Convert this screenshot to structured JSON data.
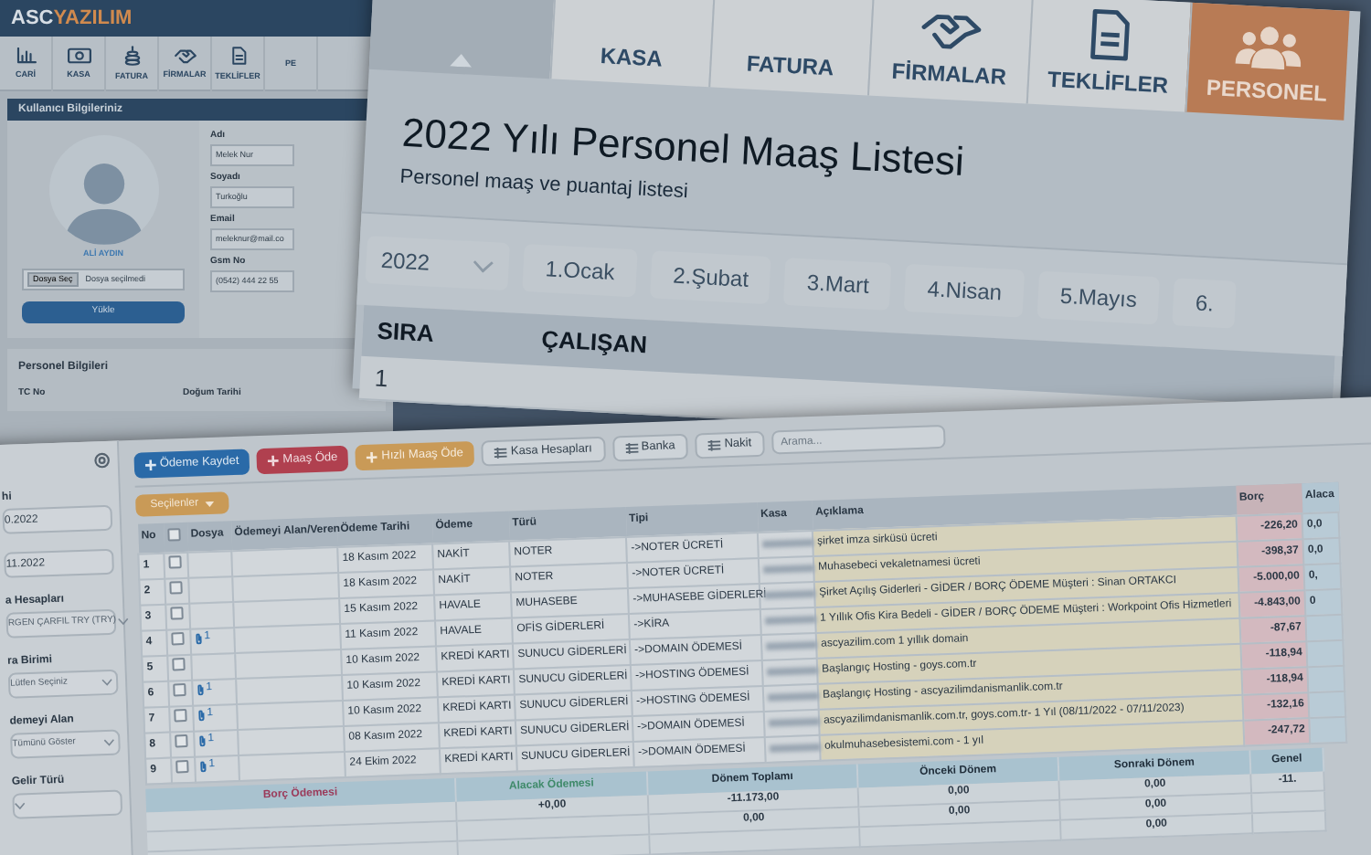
{
  "profile_window": {
    "logo_prefix": "ASC",
    "logo_suffix": "YAZILIM",
    "toolbar": [
      "CARİ",
      "KASA",
      "FATURA",
      "FİRMALAR",
      "TEKLİFLER",
      "PE"
    ],
    "section_title": "Kullanıcı Bilgileriniz",
    "avatar_caption": "ALİ AYDIN",
    "file_button": "Dosya Seç",
    "file_status": "Dosya seçilmedi",
    "upload_button": "Yükle",
    "fields": [
      {
        "label": "Adı",
        "value": "Melek Nur"
      },
      {
        "label": "Soyadı",
        "value": "Turkoğlu"
      },
      {
        "label": "Email",
        "value": "meleknur@mail.co"
      },
      {
        "label": "Gsm No",
        "value": "(0542) 444 22 55"
      }
    ],
    "personnel_title": "Personel Bilgileri",
    "personnel_columns": [
      "TC No",
      "Doğum Tarihi"
    ]
  },
  "salary_window": {
    "tabs": [
      {
        "label": "KASA",
        "selected": false
      },
      {
        "label": "FATURA",
        "selected": false
      },
      {
        "label": "FİRMALAR",
        "selected": false
      },
      {
        "label": "TEKLİFLER",
        "selected": false
      },
      {
        "label": "PERSONEL",
        "selected": true
      }
    ],
    "title": "2022 Yılı Personel Maaş Listesi",
    "subtitle": "Personel maaş ve puantaj listesi",
    "year": "2022",
    "months": [
      "1.Ocak",
      "2.Şubat",
      "3.Mart",
      "4.Nisan",
      "5.Mayıs",
      "6."
    ],
    "columns": [
      "SIRA",
      "ÇALIŞAN"
    ],
    "rows": [
      "1"
    ]
  },
  "payments_window": {
    "sidebar": [
      {
        "kind": "input",
        "label": "hi",
        "value": "0.2022"
      },
      {
        "kind": "input",
        "value": "11.2022"
      },
      {
        "kind": "select",
        "label": "a Hesapları",
        "value": "RGEN ÇARFIL TRY (TRY)"
      },
      {
        "kind": "select",
        "label": "ra Birimi",
        "value": "Lütfen Seçiniz"
      },
      {
        "kind": "select",
        "label": "demeyi Alan",
        "value": "Tümünü Göster"
      },
      {
        "kind": "select",
        "label": "Gelir Türü"
      }
    ],
    "buttons": [
      {
        "label": "Ödeme Kaydet",
        "kind": "primary"
      },
      {
        "label": "Maaş Öde",
        "kind": "danger"
      },
      {
        "label": "Hızlı Maaş Öde",
        "kind": "warning"
      },
      {
        "label": "Kasa Hesapları",
        "kind": "default"
      },
      {
        "label": "Banka",
        "kind": "default"
      },
      {
        "label": "Nakit",
        "kind": "default"
      }
    ],
    "search": {
      "placeholder": "Arama..."
    },
    "bulk_button": "Seçilenler",
    "table": {
      "select_all_checked": false,
      "columns": [
        "No",
        "Dosya",
        "Ödemeyi Alan/Veren",
        "Ödeme Tarihi",
        "Ödeme",
        "Türü",
        "Tipi",
        "Kasa",
        "Açıklama",
        "Borç",
        "Alaca"
      ],
      "rows": [
        {
          "no": "1",
          "checked": false,
          "date": "18 Kasım 2022",
          "method": "NAKİT",
          "category": "NOTER",
          "type": "->NOTER ÜCRETİ",
          "description": "şirket imza sirküsü ücreti",
          "debit": "-226,20",
          "credit": "0,0"
        },
        {
          "no": "2",
          "checked": false,
          "date": "18 Kasım 2022",
          "method": "NAKİT",
          "category": "NOTER",
          "type": "->NOTER ÜCRETİ",
          "description": "Muhasebeci vekaletnamesi ücreti",
          "debit": "-398,37",
          "credit": "0,0"
        },
        {
          "no": "3",
          "checked": false,
          "date": "15 Kasım 2022",
          "method": "HAVALE",
          "category": "MUHASEBE",
          "type": "->MUHASEBE GİDERLERİ",
          "description": "Şirket Açılış Giderleri - GİDER / BORÇ ÖDEME Müşteri : Sinan ORTAKCI",
          "debit": "-5.000,00",
          "credit": "0,"
        },
        {
          "no": "4",
          "checked": false,
          "attachment": "1",
          "date": "11 Kasım 2022",
          "method": "HAVALE",
          "category": "OFİS GİDERLERİ",
          "type": "->KİRA",
          "description": "1 Yıllık Ofis Kira Bedeli - GİDER / BORÇ ÖDEME Müşteri : Workpoint Ofis Hizmetleri",
          "debit": "-4.843,00",
          "credit": "0"
        },
        {
          "no": "5",
          "checked": false,
          "date": "10 Kasım 2022",
          "method": "KREDİ KARTI",
          "category": "SUNUCU GİDERLERİ",
          "type": "->DOMAIN ÖDEMESİ",
          "description": "ascyazilim.com 1 yıllık domain",
          "debit": "-87,67"
        },
        {
          "no": "6",
          "checked": false,
          "attachment": "1",
          "date": "10 Kasım 2022",
          "method": "KREDİ KARTI",
          "category": "SUNUCU GİDERLERİ",
          "type": "->HOSTING ÖDEMESİ",
          "description": "Başlangıç Hosting - goys.com.tr",
          "debit": "-118,94"
        },
        {
          "no": "7",
          "checked": false,
          "attachment": "1",
          "date": "10 Kasım 2022",
          "method": "KREDİ KARTI",
          "category": "SUNUCU GİDERLERİ",
          "type": "->HOSTING ÖDEMESİ",
          "description": "Başlangıç Hosting - ascyazilimdanismanlik.com.tr",
          "debit": "-118,94"
        },
        {
          "no": "8",
          "checked": false,
          "attachment": "1",
          "date": "08 Kasım 2022",
          "method": "KREDİ KARTI",
          "category": "SUNUCU GİDERLERİ",
          "type": "->DOMAIN ÖDEMESİ",
          "description": "ascyazilimdanismanlik.com.tr, goys.com.tr- 1 Yıl (08/11/2022 - 07/11/2023)",
          "debit": "-132,16"
        },
        {
          "no": "9",
          "checked": false,
          "attachment": "1",
          "date": "24 Ekim 2022",
          "method": "KREDİ KARTI",
          "category": "SUNUCU GİDERLERİ",
          "type": "->DOMAIN ÖDEMESİ",
          "description": "okulmuhasebesistemi.com - 1 yıl",
          "debit": "-247,72"
        }
      ]
    },
    "summary": [
      {
        "label": "Borç Ödemesi",
        "color": "#9b3a5a"
      },
      {
        "label": "Alacak Ödemesi",
        "color": "#3f8a6a",
        "values": [
          "+0,00"
        ]
      },
      {
        "label": "Dönem Toplamı",
        "color": "#1f2d3a",
        "values": [
          "-11.173,00",
          "0,00"
        ]
      },
      {
        "label": "Önceki Dönem",
        "color": "#1f2d3a",
        "values": [
          "0,00",
          "0,00"
        ]
      },
      {
        "label": "Sonraki Dönem",
        "color": "#1f2d3a",
        "values": [
          "0,00",
          "0,00",
          "0,00"
        ]
      },
      {
        "label": "Genel",
        "color": "#1f2d3a",
        "values": [
          "-11."
        ]
      }
    ]
  }
}
